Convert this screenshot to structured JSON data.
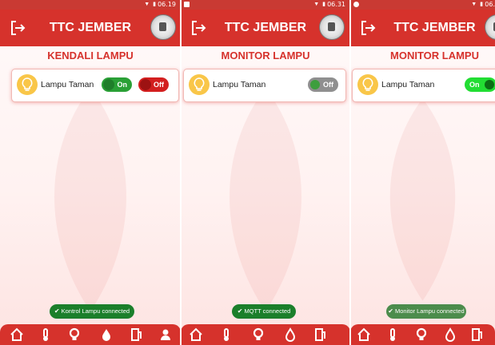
{
  "app": {
    "title": "TTC JEMBER"
  },
  "screens": [
    {
      "status_time": "06.19",
      "page_title": "KENDALI LAMPU",
      "device_label": "Lampu Taman",
      "on_label": "On",
      "off_label": "Off",
      "toast": "Kontrol Lampu connected"
    },
    {
      "status_time": "06.31",
      "page_title": "MONITOR LAMPU",
      "device_label": "Lampu Taman",
      "state_label": "Off",
      "toast": "MQTT connected"
    },
    {
      "status_time": "06.",
      "page_title": "MONITOR LAMPU",
      "device_label": "Lampu Taman",
      "state_label": "On",
      "toast": "Monitor Lampu connected"
    }
  ],
  "nav": {
    "icons": [
      "home-icon",
      "thermometer-icon",
      "lightbulb-icon",
      "water-drop-icon",
      "fuel-pump-icon",
      "person-icon"
    ]
  },
  "colors": {
    "primary": "#d6322c",
    "on_green": "#2aa036",
    "off_red": "#d31f1f",
    "toast_green": "#1b7f2b",
    "bulb_yellow": "#f9c648"
  }
}
